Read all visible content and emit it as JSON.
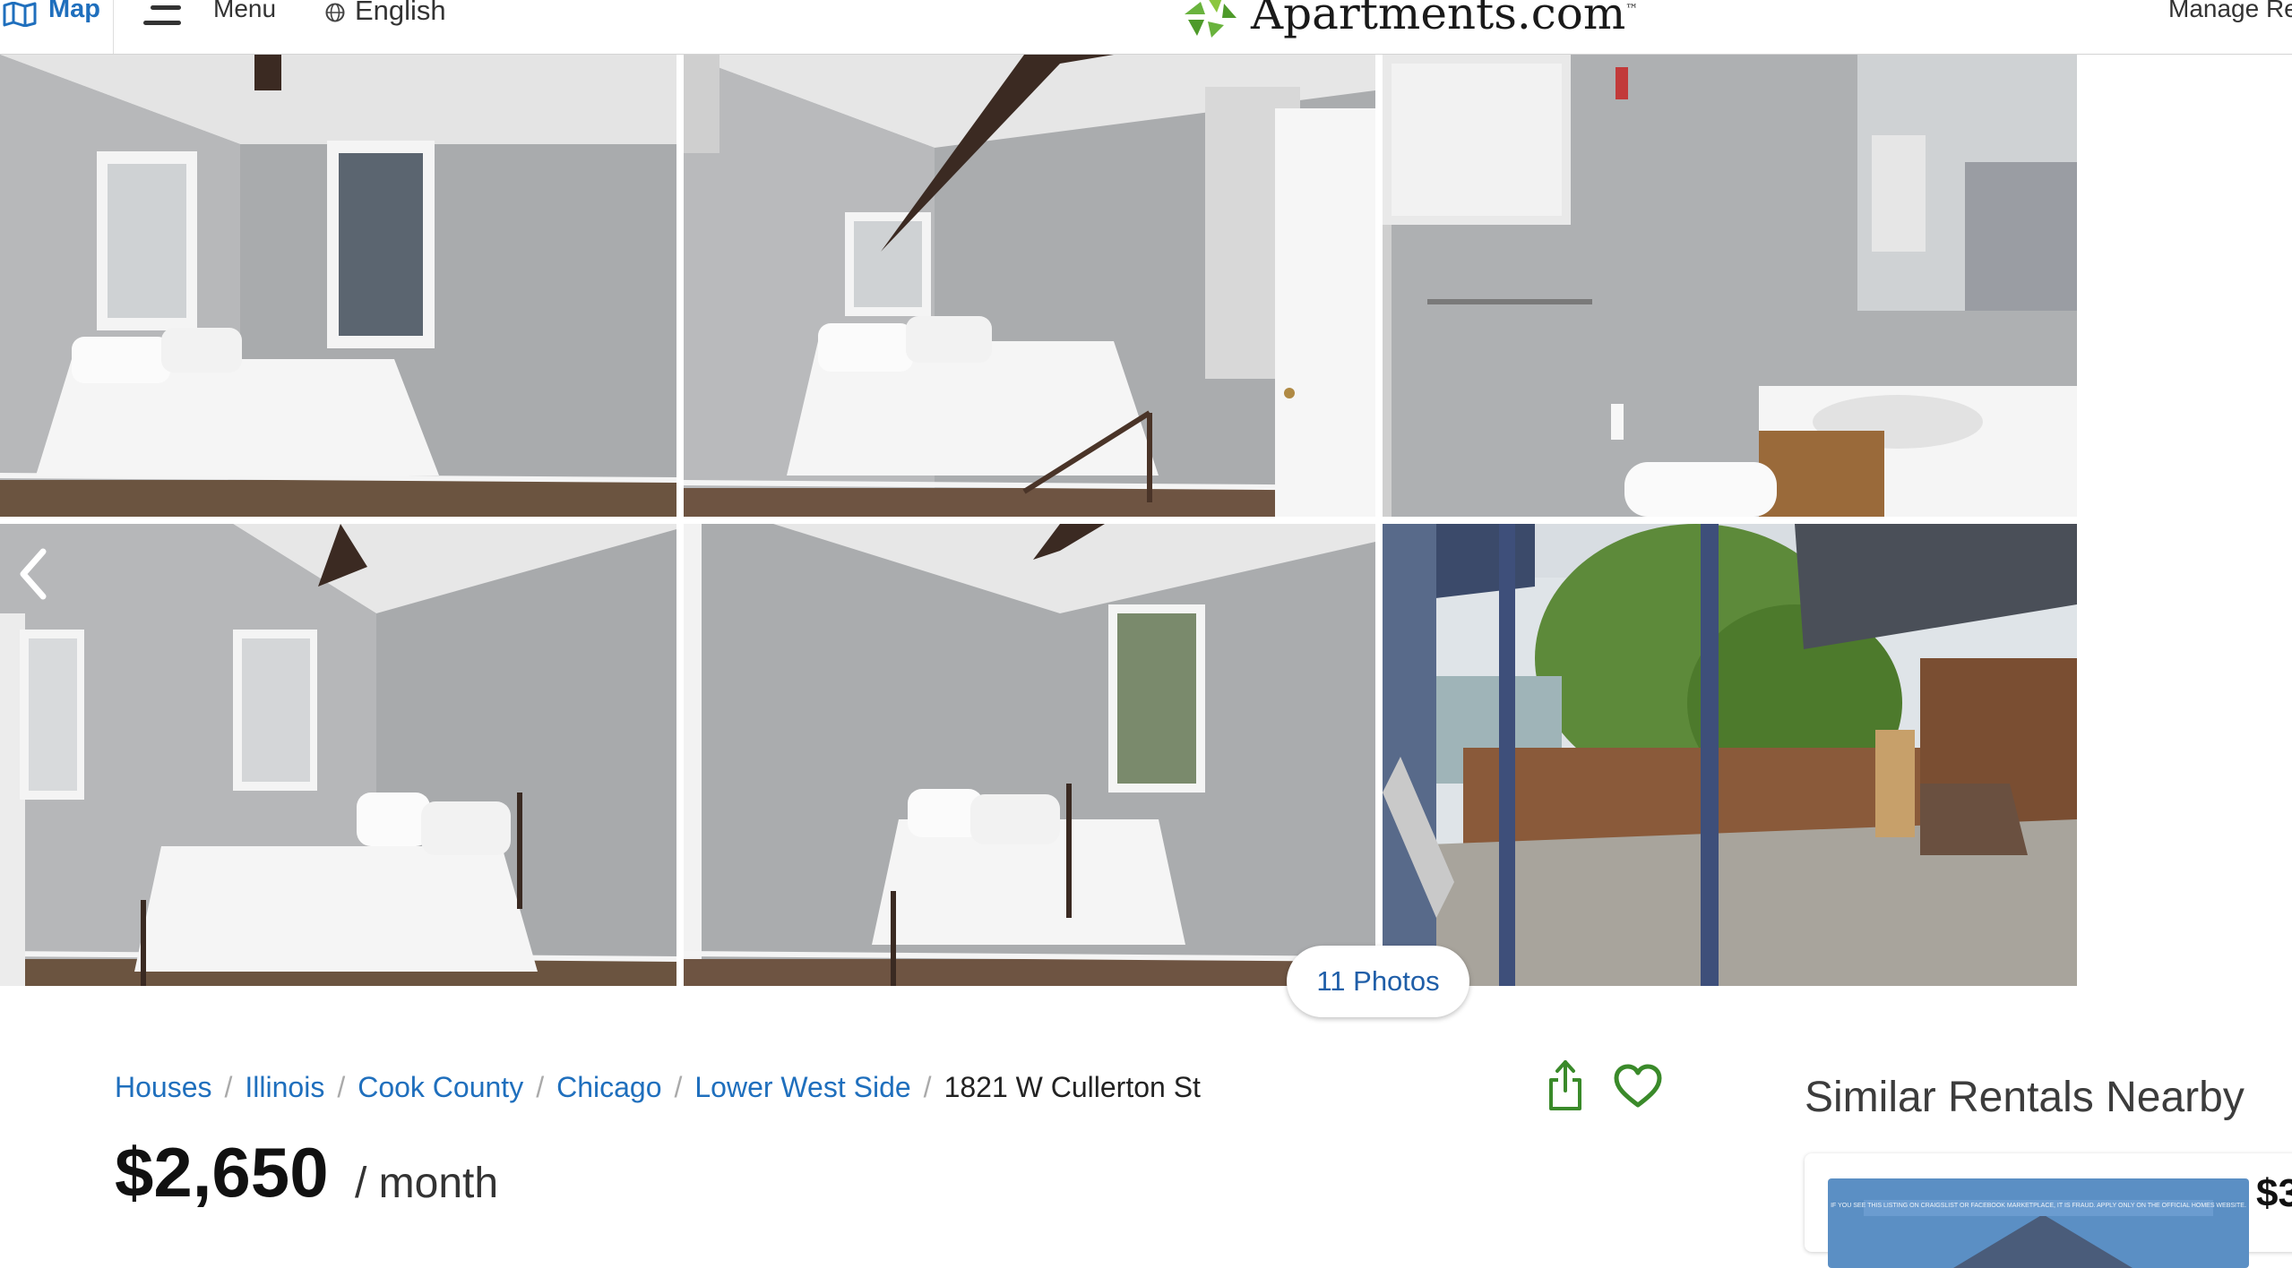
{
  "header": {
    "map_label": "Map",
    "menu_label": "Menu",
    "language_label": "English",
    "logo_text": "Apartments.com",
    "logo_tm": "™",
    "manage_label": "Manage Re"
  },
  "gallery": {
    "photo_count_label": "11 Photos",
    "photos": [
      {
        "room": "bedroom"
      },
      {
        "room": "bedroom"
      },
      {
        "room": "bathroom"
      },
      {
        "room": "bedroom"
      },
      {
        "room": "bedroom"
      },
      {
        "room": "backyard patio"
      }
    ]
  },
  "breadcrumb": {
    "items": [
      "Houses",
      "Illinois",
      "Cook County",
      "Chicago",
      "Lower West Side"
    ],
    "separator": "/",
    "current": "1821 W Cullerton St"
  },
  "listing": {
    "price": "$2,650",
    "period": "/ month"
  },
  "similar": {
    "title": "Similar Rentals Nearby",
    "card_price": "$3",
    "thumb_caption": "IF YOU SEE THIS LISTING ON CRAIGSLIST OR FACEBOOK MARKETPLACE, IT IS FRAUD. APPLY ONLY ON THE OFFICIAL HOMES WEBSITE."
  },
  "colors": {
    "link": "#1f6fbd",
    "brand_green": "#69b33d",
    "icon_green": "#3a8a2a",
    "wall_gray": "#a9abad"
  },
  "icons": [
    "map-icon",
    "menu-icon",
    "globe-icon",
    "apartments-logo-icon",
    "chevron-left-icon",
    "share-icon",
    "heart-icon"
  ]
}
